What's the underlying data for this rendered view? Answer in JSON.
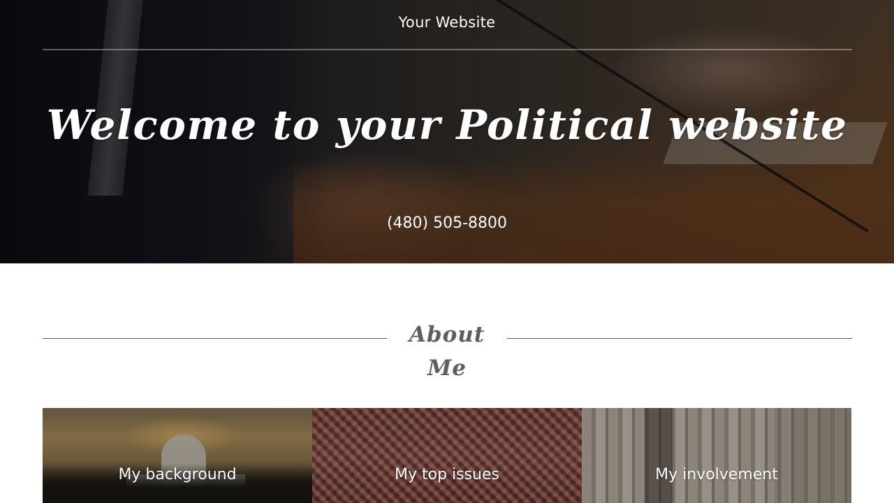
{
  "header": {
    "site_title": "Your Website"
  },
  "hero": {
    "heading": "Welcome to your Political website",
    "phone": "(480) 505-8800"
  },
  "about": {
    "title": "About Me",
    "tiles": [
      {
        "label": "My background"
      },
      {
        "label": "My top issues"
      },
      {
        "label": "My involvement"
      }
    ]
  },
  "colors": {
    "hero_text": "#ffffff",
    "section_title": "#5e5e5e",
    "divider": "#555555"
  }
}
